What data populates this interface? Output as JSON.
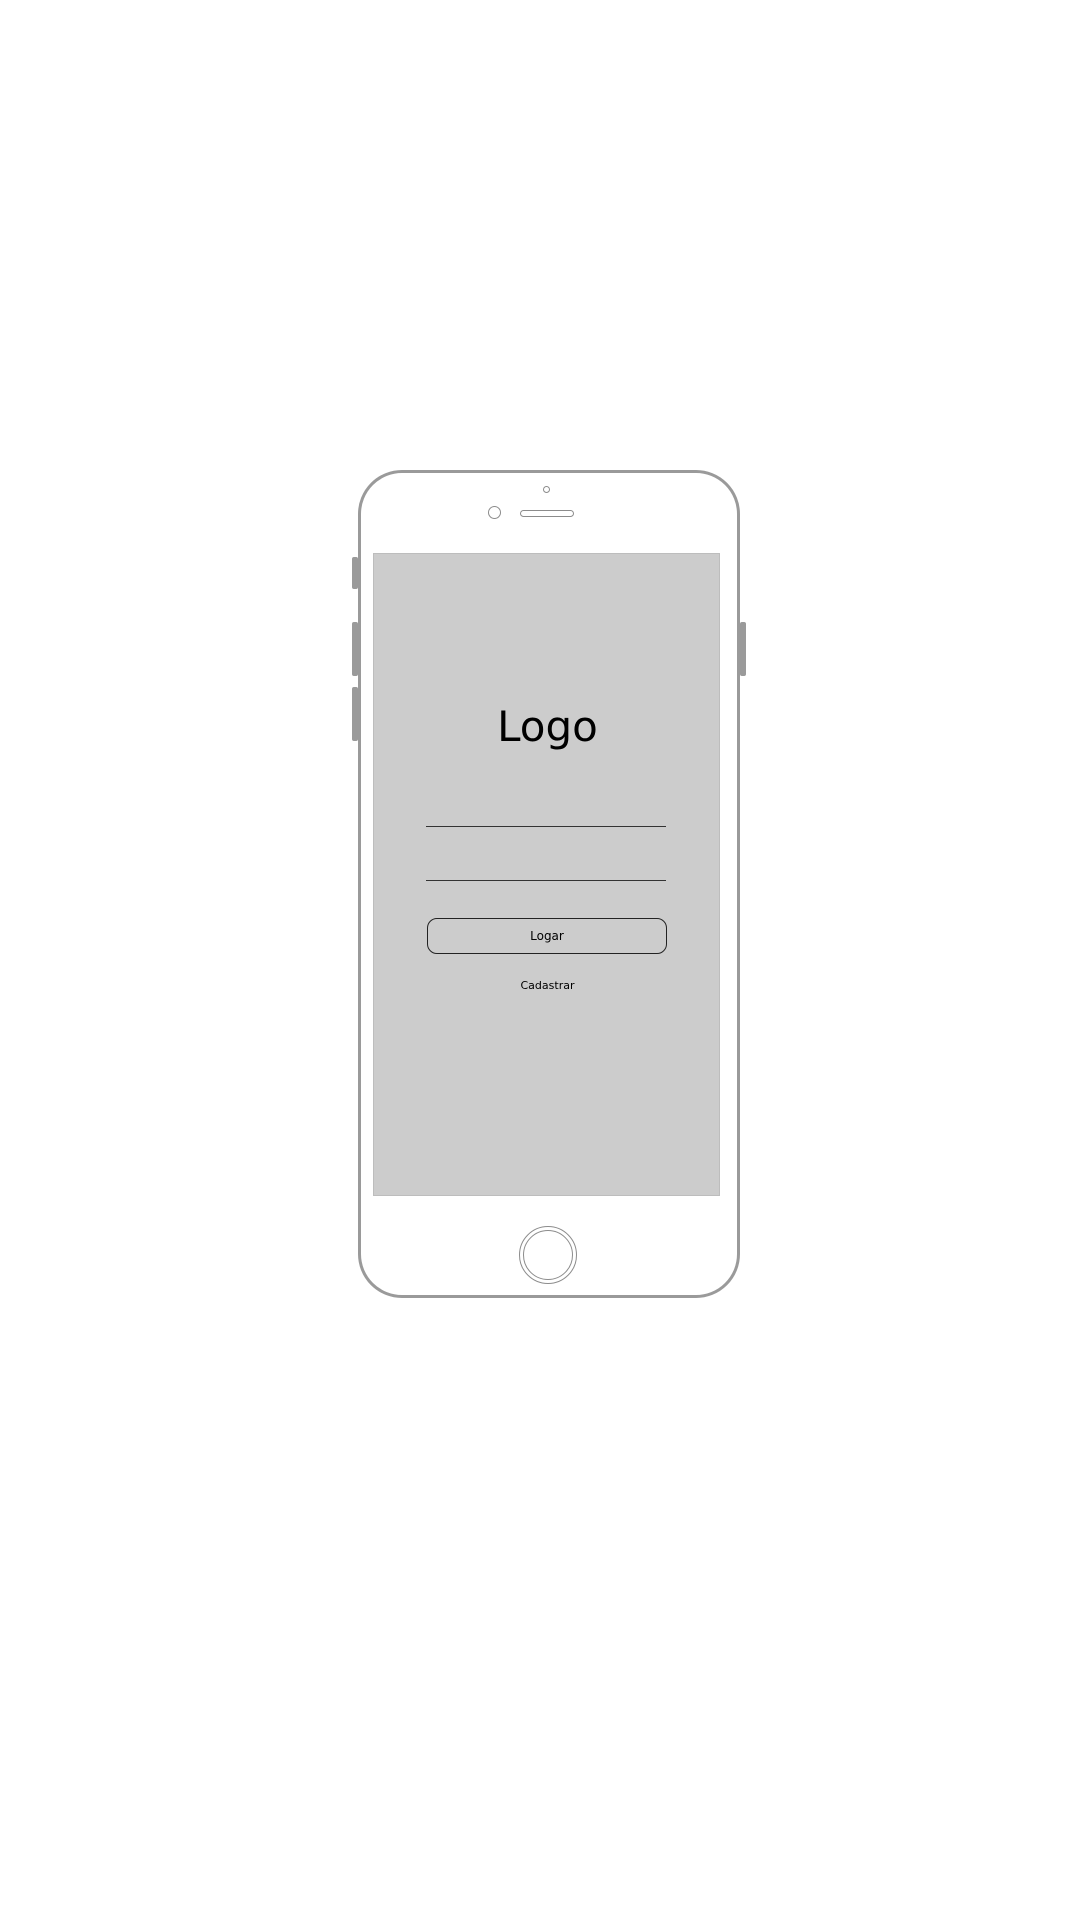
{
  "screen": {
    "logo_text": "Logo",
    "username_field": {
      "value": "",
      "placeholder": ""
    },
    "password_field": {
      "value": "",
      "placeholder": ""
    },
    "login_button_label": "Logar",
    "signup_link_label": "Cadastrar"
  },
  "colors": {
    "screen_background": "#cccccc",
    "device_frame": "#9a9a9a",
    "page_background": "#ffffff"
  }
}
